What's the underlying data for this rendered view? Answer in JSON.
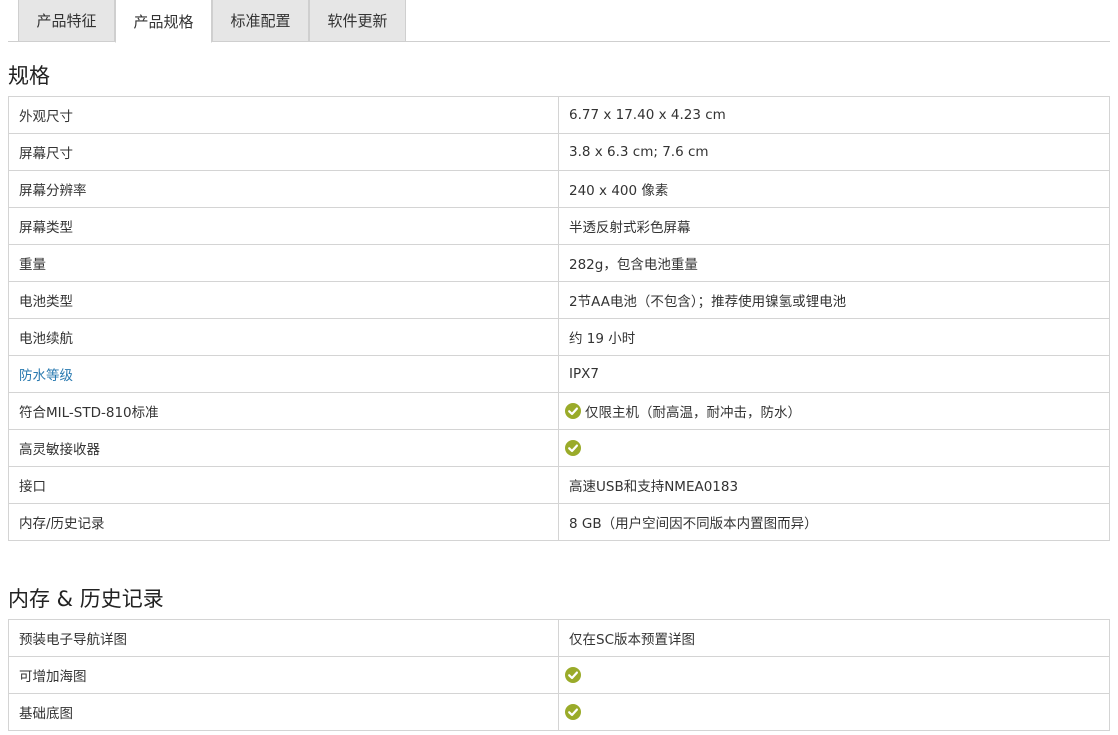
{
  "tabs": [
    {
      "label": "产品特征",
      "active": false
    },
    {
      "label": "产品规格",
      "active": true
    },
    {
      "label": "标准配置",
      "active": false
    },
    {
      "label": "软件更新",
      "active": false
    }
  ],
  "sections": [
    {
      "title": "规格",
      "rows": [
        {
          "label": "外观尺寸",
          "value": "6.77 x 17.40 x 4.23 cm",
          "check": false,
          "link": false
        },
        {
          "label": "屏幕尺寸",
          "value": "3.8 x 6.3 cm; 7.6 cm",
          "check": false,
          "link": false
        },
        {
          "label": "屏幕分辨率",
          "value": "240 x 400 像素",
          "check": false,
          "link": false
        },
        {
          "label": "屏幕类型",
          "value": "半透反射式彩色屏幕",
          "check": false,
          "link": false
        },
        {
          "label": "重量",
          "value": "282g，包含电池重量",
          "check": false,
          "link": false
        },
        {
          "label": "电池类型",
          "value": "2节AA电池（不包含）；推荐使用镍氢或锂电池",
          "check": false,
          "link": false
        },
        {
          "label": "电池续航",
          "value": "约 19 小时",
          "check": false,
          "link": false
        },
        {
          "label": "防水等级",
          "value": "IPX7",
          "check": false,
          "link": true
        },
        {
          "label": "符合MIL-STD-810标准",
          "value": "仅限主机（耐高温，耐冲击，防水）",
          "check": true,
          "link": false
        },
        {
          "label": "高灵敏接收器",
          "value": "",
          "check": true,
          "link": false
        },
        {
          "label": "接口",
          "value": "高速USB和支持NMEA0183",
          "check": false,
          "link": false
        },
        {
          "label": "内存/历史记录",
          "value": "8 GB（用户空间因不同版本内置图而异）",
          "check": false,
          "link": false
        }
      ]
    },
    {
      "title": "内存 & 历史记录",
      "rows": [
        {
          "label": "预装电子导航详图",
          "value": "仅在SC版本预置详图",
          "check": false,
          "link": false
        },
        {
          "label": "可增加海图",
          "value": "",
          "check": true,
          "link": false
        },
        {
          "label": "基础底图",
          "value": "",
          "check": true,
          "link": false
        }
      ]
    }
  ],
  "colors": {
    "check": "#9aab2a",
    "link": "#2a7ab0",
    "tab_inactive": "#e6e6e6",
    "border": "#d4d4d4"
  },
  "icons": {
    "check": "check-circle-icon"
  }
}
